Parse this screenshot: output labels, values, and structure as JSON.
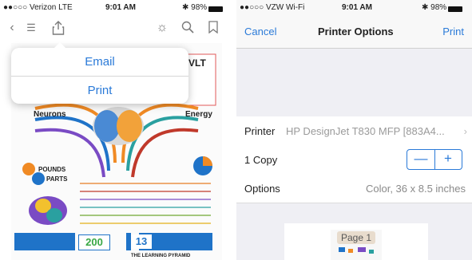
{
  "left": {
    "status": {
      "carrier": "●●○○○ Verizon  LTE",
      "time": "9:01 AM",
      "battery": "✱ 98%"
    },
    "popover": {
      "email": "Email",
      "print": "Print"
    },
    "infographic": {
      "neurons_title": "Neurons",
      "energy_title": "Energy",
      "pounds_line1": "POUNDS",
      "pounds_line2": "PARTS",
      "stat1": "200",
      "stat2": "13",
      "footer_title": "THE LEARNING PYRAMID",
      "corner_text": "VLT"
    }
  },
  "right": {
    "status": {
      "carrier": "●●○○○ VZW Wi-Fi",
      "time": "9:01 AM",
      "battery": "✱ 98%"
    },
    "nav": {
      "cancel": "Cancel",
      "title": "Printer Options",
      "print": "Print"
    },
    "printer": {
      "label": "Printer",
      "value": "HP DesignJet T830 MFP [883A4..."
    },
    "copies": {
      "label": "1 Copy",
      "minus": "—",
      "plus": "+"
    },
    "options": {
      "label": "Options",
      "value": "Color, 36 x 8.5 inches"
    },
    "preview": {
      "page_label": "Page 1"
    }
  },
  "colors": {
    "accent": "#2a7ad8",
    "orange": "#f08a24",
    "purple": "#7a4bc4",
    "blue": "#1f73c8"
  }
}
